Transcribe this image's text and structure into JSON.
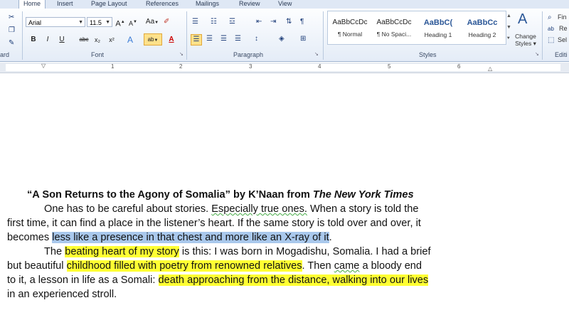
{
  "tabs": [
    "Home",
    "Insert",
    "Page Layout",
    "References",
    "Mailings",
    "Review",
    "View"
  ],
  "font": {
    "name": "Arial",
    "size": "11.5",
    "grow_label": "A",
    "shrink_label": "A",
    "case_label": "Aa",
    "bold": "B",
    "italic": "I",
    "underline": "U",
    "strike": "abc",
    "subscript": "x₂",
    "superscript": "x²",
    "effects": "A",
    "highlight": "ab",
    "color": "A",
    "group_label": "Font"
  },
  "clipboard_label": "ard",
  "paragraph": {
    "group_label": "Paragraph"
  },
  "styles": {
    "group_label": "Styles",
    "items": [
      {
        "sample": "AaBbCcDc",
        "name": "¶ Normal"
      },
      {
        "sample": "AaBbCcDc",
        "name": "¶ No Spaci..."
      },
      {
        "sample": "AaBbC(",
        "name": "Heading 1"
      },
      {
        "sample": "AaBbCc",
        "name": "Heading 2"
      }
    ],
    "change_styles": "Change Styles ▾"
  },
  "editing": {
    "find": "Fin",
    "replace": "Re",
    "select": "Sel",
    "group_label": "Editi"
  },
  "ruler": [
    "1",
    "2",
    "3",
    "4",
    "5",
    "6"
  ],
  "document": {
    "title_part1": "“A Son Returns to the Agony of Somalia” by K’Naan from ",
    "title_italic": "The New York Times",
    "l1a": "One has to be careful about stories. ",
    "l1b": "Especially true ones.",
    "l1c": " When a story is told the",
    "l2": "first time, it can find a place in the listener’s heart. If the same story is told over and over, it",
    "l3a": "becomes ",
    "l3b": "less like a presence in that chest and more like an X-ray of it",
    "l3c": ".",
    "l4a": "The ",
    "l4b": "beating heart of my story",
    "l4c": " is this: I was born in Mogadishu, Somalia. I had a brief",
    "l5a": "but beautiful ",
    "l5b": "childhood filled with poetry from renowned relatives",
    "l5c": ". Then ",
    "l5d": "came",
    "l5e": " a bloody end",
    "l6a": "to it, a lesson in life as a Somali: ",
    "l6b": "death approaching from the distance, walking into our lives",
    "l7": "in an experienced stroll."
  }
}
